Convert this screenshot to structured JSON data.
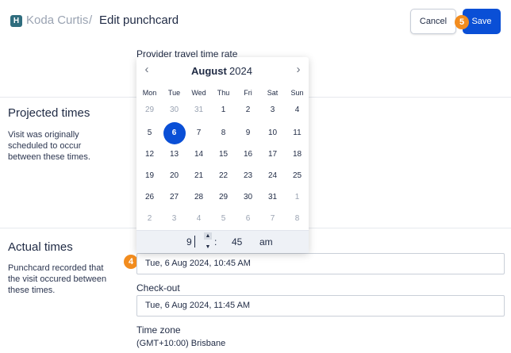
{
  "header": {
    "logo_letter": "H",
    "breadcrumb_parent": "Koda Curtis",
    "breadcrumb_separator": "/",
    "page_title": "Edit punchcard",
    "cancel_label": "Cancel",
    "save_label": "Save"
  },
  "badges": {
    "save_step": "5",
    "checkin_step": "4"
  },
  "top_field_label": "Provider travel time rate",
  "projected": {
    "title": "Projected times",
    "description": "Visit was originally scheduled to occur between these times."
  },
  "actual": {
    "title": "Actual times",
    "description": "Punchcard recorded that the visit occured between these times."
  },
  "check_in_value": "Tue, 6 Aug 2024, 10:45 AM",
  "check_out": {
    "label": "Check-out",
    "value": "Tue, 6 Aug 2024, 11:45 AM"
  },
  "timezone": {
    "label": "Time zone",
    "value": "(GMT+10:00) Brisbane"
  },
  "calendar": {
    "prev_icon": "‹",
    "next_icon": "›",
    "month": "August",
    "year": "2024",
    "weekdays": [
      "Mon",
      "Tue",
      "Wed",
      "Thu",
      "Fri",
      "Sat",
      "Sun"
    ],
    "weeks": [
      [
        "29",
        "30",
        "31",
        "1",
        "2",
        "3",
        "4"
      ],
      [
        "5",
        "6",
        "7",
        "8",
        "9",
        "10",
        "11"
      ],
      [
        "12",
        "13",
        "14",
        "15",
        "16",
        "17",
        "18"
      ],
      [
        "19",
        "20",
        "21",
        "22",
        "23",
        "24",
        "25"
      ],
      [
        "26",
        "27",
        "28",
        "29",
        "30",
        "31",
        "1"
      ],
      [
        "2",
        "3",
        "4",
        "5",
        "6",
        "7",
        "8"
      ]
    ],
    "selected_day": "6",
    "time": {
      "hour": "9",
      "separator": ":",
      "minute": "45",
      "ampm": "am",
      "up_icon": "▲",
      "down_icon": "▼"
    }
  },
  "colors": {
    "accent": "#0a4fd6",
    "badge": "#f28c1e",
    "logo": "#2f6d7e"
  }
}
